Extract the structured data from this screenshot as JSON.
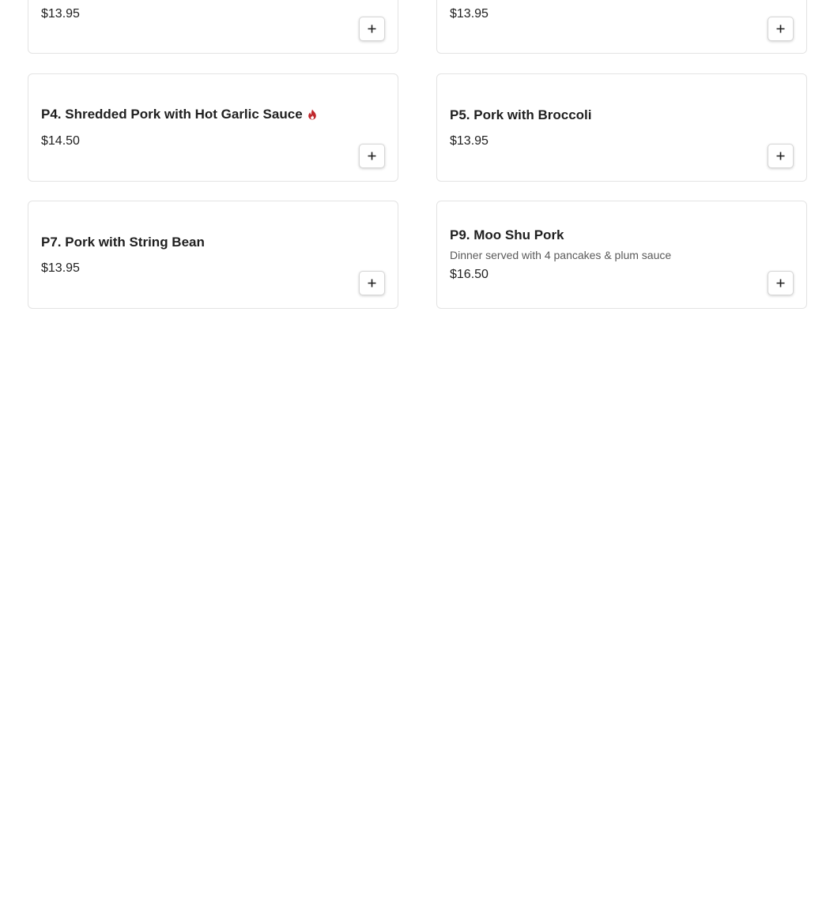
{
  "menu_items": [
    {
      "title": "",
      "description": "",
      "price": "$13.95",
      "spicy": false
    },
    {
      "title": "",
      "description": "",
      "price": "$13.95",
      "spicy": false
    },
    {
      "title": "P4. Shredded Pork with Hot Garlic Sauce",
      "description": "",
      "price": "$14.50",
      "spicy": true
    },
    {
      "title": "P5. Pork with Broccoli",
      "description": "",
      "price": "$13.95",
      "spicy": false
    },
    {
      "title": "P7. Pork with String Bean",
      "description": "",
      "price": "$13.95",
      "spicy": false
    },
    {
      "title": "P9. Moo Shu Pork",
      "description": "Dinner served with 4 pancakes & plum sauce",
      "price": "$16.50",
      "spicy": false
    }
  ],
  "icons": {
    "add": "plus-icon",
    "spicy": "flame-icon"
  },
  "colors": {
    "spicy": "#c0282d",
    "border": "#e3e3e3"
  }
}
